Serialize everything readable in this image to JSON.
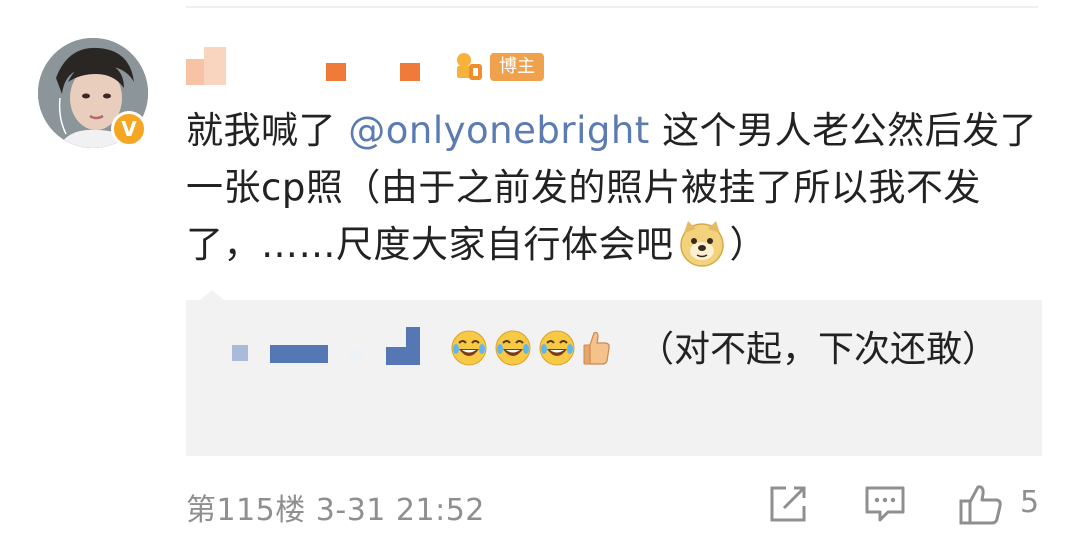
{
  "comment": {
    "author_badge": "博主",
    "verified_mark": "V",
    "text_before_mention": "就我喊了 ",
    "mention": "@onlyonebright",
    "text_after_mention": " 这个男人老公然后发了一张cp照（由于之前发的照片被挂了所以我不发了，……尺度大家自行体会吧",
    "text_close": "）",
    "emoji_doge": "doge-emoji"
  },
  "reply": {
    "emojis": [
      "laugh-cry-emoji",
      "laugh-cry-emoji",
      "laugh-cry-emoji",
      "thumbs-up-emoji"
    ],
    "text": "（对不起，下次还敢）"
  },
  "footer": {
    "floor_time": "第115楼 3-31 21:52",
    "like_count": "5"
  },
  "colors": {
    "mention": "#5b7bb2",
    "badge": "#f0a14b",
    "verified": "#f5a623",
    "meta_gray": "#8f8f8f",
    "reply_bg": "#f2f2f2"
  }
}
